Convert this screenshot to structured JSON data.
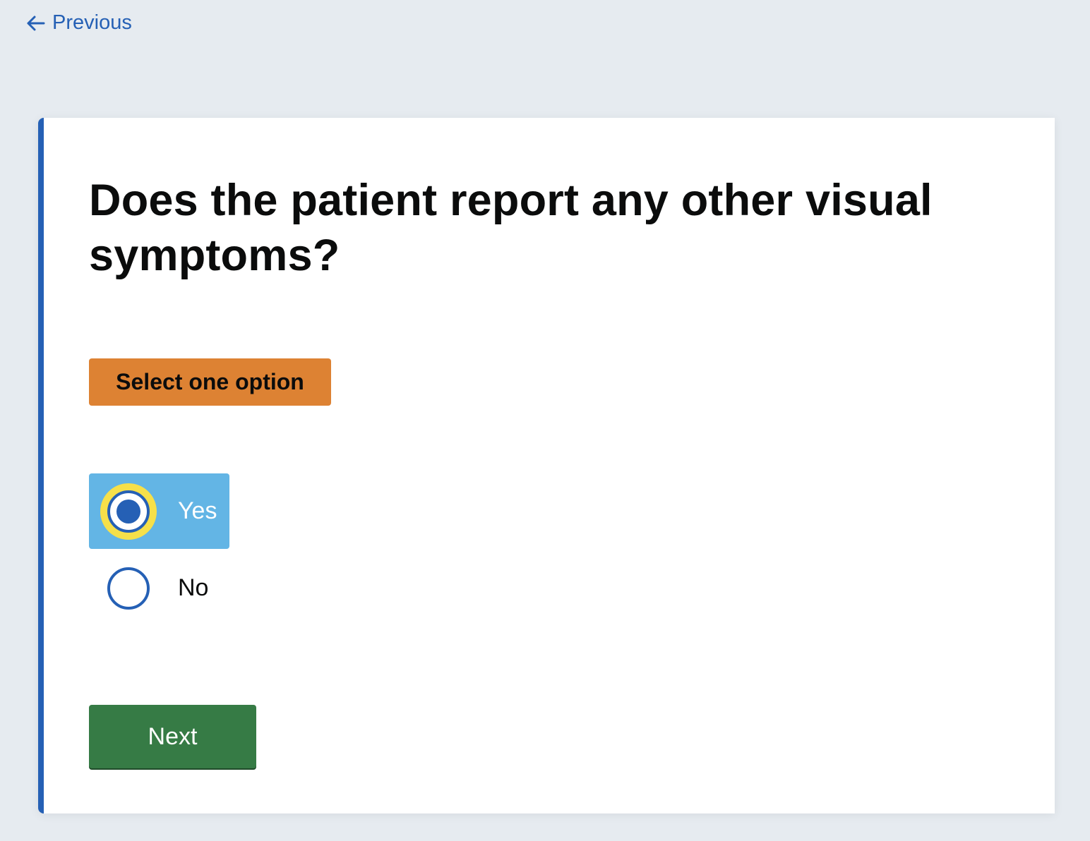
{
  "nav": {
    "previous_label": "Previous"
  },
  "question": {
    "title": "Does the patient report any other visual symptoms?",
    "hint": "Select one option"
  },
  "options": [
    {
      "label": "Yes",
      "selected": true
    },
    {
      "label": "No",
      "selected": false
    }
  ],
  "actions": {
    "next_label": "Next"
  },
  "colors": {
    "page_background": "#e6ebf0",
    "accent_blue": "#2560b5",
    "hint_orange": "#dd8233",
    "selected_option_bg": "#63b5e5",
    "focus_yellow": "#f6e04a",
    "next_green": "#367b45"
  },
  "icons": {
    "previous": "arrow-left-icon"
  }
}
